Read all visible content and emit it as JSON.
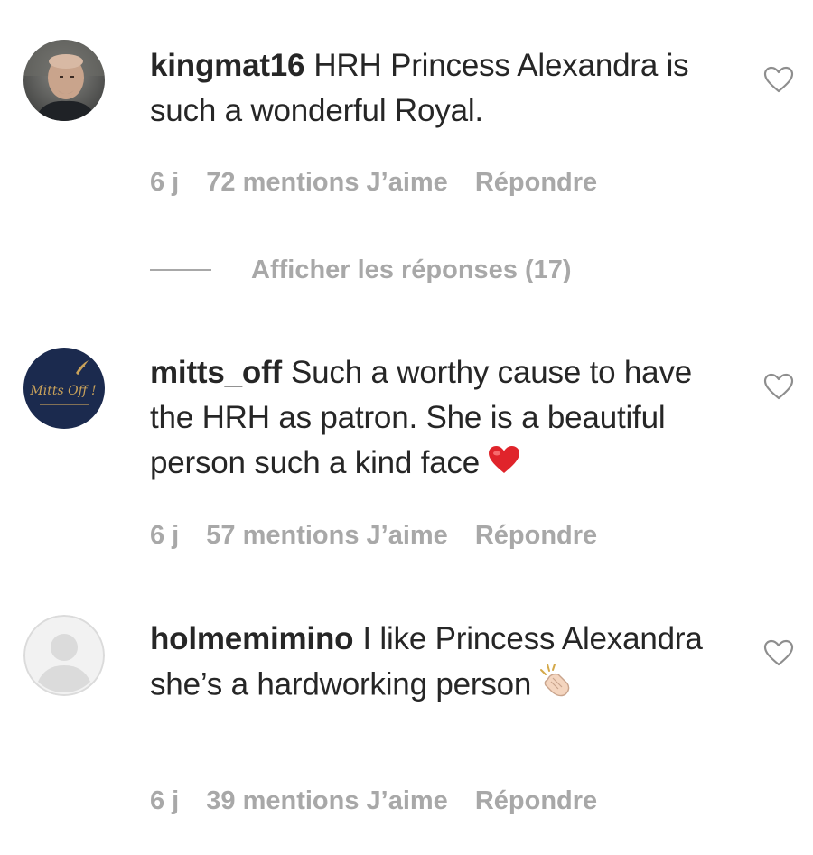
{
  "comments": [
    {
      "username": "kingmat16",
      "text": "HRH Princess Alexandra is such a wonderful Royal.",
      "avatar_icon": "user-photo-avatar",
      "time": "6 j",
      "likes": "72 mentions J’aime",
      "reply": "Répondre",
      "view_replies": "Afficher les réponses (17)"
    },
    {
      "username": "mitts_off",
      "text": "Such a worthy cause to have the HRH as patron. She is a beautiful person such a kind face",
      "emoji": "red-heart-icon",
      "avatar_icon": "mitts-off-logo-avatar",
      "avatar_text": "Mitts Off !",
      "time": "6 j",
      "likes": "57 mentions J’aime",
      "reply": "Répondre"
    },
    {
      "username": "holmemimino",
      "text": "I like Princess Alexandra she’s a hardworking person",
      "emoji": "clapping-hands-icon",
      "avatar_icon": "default-avatar",
      "time": "6 j",
      "likes": "39 mentions J’aime",
      "reply": "Répondre"
    }
  ],
  "colors": {
    "text": "#262626",
    "secondary": "#a8a8a8",
    "heart_red": "#e0242b",
    "logo_navy": "#1b2a4e",
    "logo_gold": "#c9a25a"
  }
}
